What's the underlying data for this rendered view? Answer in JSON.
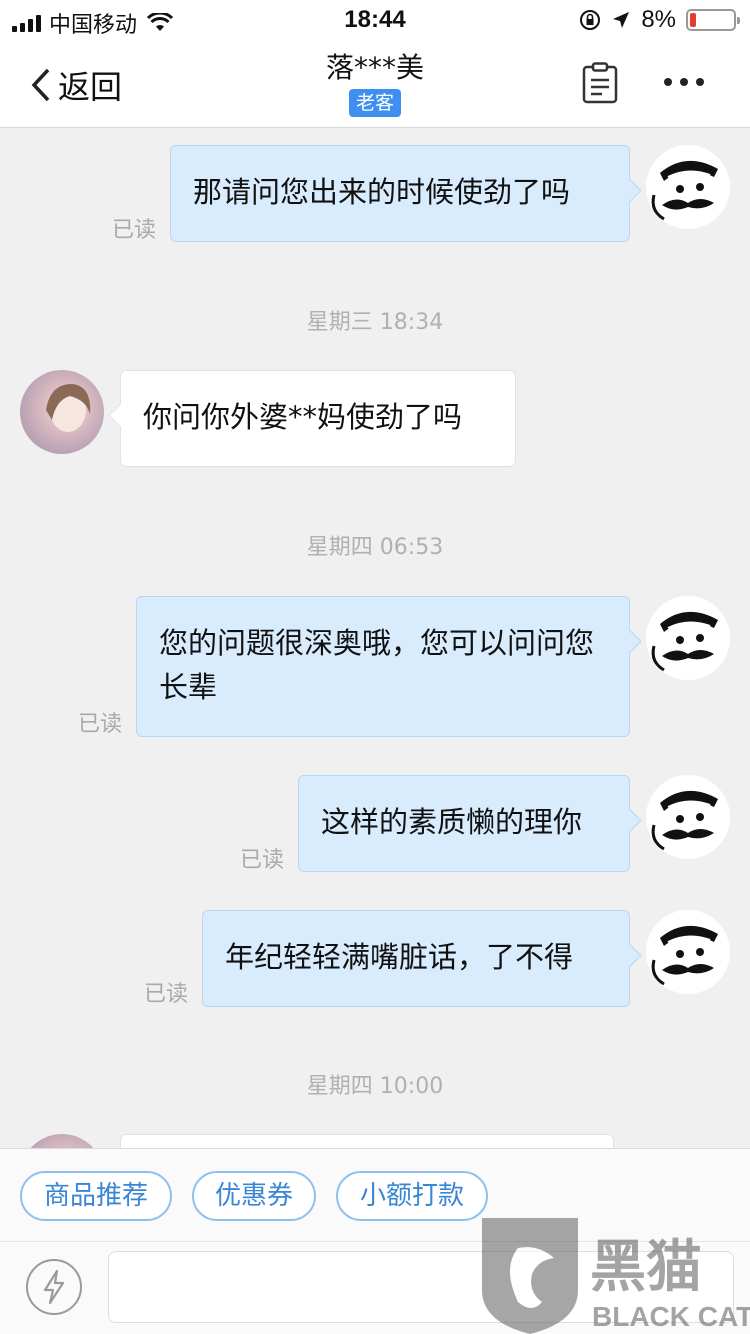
{
  "status_bar": {
    "carrier": "中国移动",
    "time": "18:44",
    "battery_percent": "8%",
    "battery_level": 0.08,
    "battery_color": "#e63b2e"
  },
  "nav": {
    "back_label": "返回",
    "title": "落***美",
    "badge": "老客"
  },
  "messages": [
    {
      "text": "那请问您出来的时候使劲了吗",
      "status": "已读"
    },
    {
      "timestamp": "星期三 18:34"
    },
    {
      "text": "你问你外婆**妈使劲了吗"
    },
    {
      "timestamp": "星期四 06:53"
    },
    {
      "text": "您的问题很深奥哦，您可以问问您长辈",
      "status": "已读"
    },
    {
      "text": "这样的素质懒的理你",
      "status": "已读"
    },
    {
      "text": "年纪轻轻满嘴脏话，了不得",
      "status": "已读"
    },
    {
      "timestamp": "星期四 10:00"
    }
  ],
  "quick_actions": [
    "商品推荐",
    "优惠券",
    "小额打款"
  ],
  "watermark": {
    "cn": "黑猫",
    "en": "BLACK CAT"
  },
  "colors": {
    "accent": "#3f8ff0",
    "outgoing_bubble": "#d9ecfd",
    "quick_action_text": "#3a86d6"
  }
}
